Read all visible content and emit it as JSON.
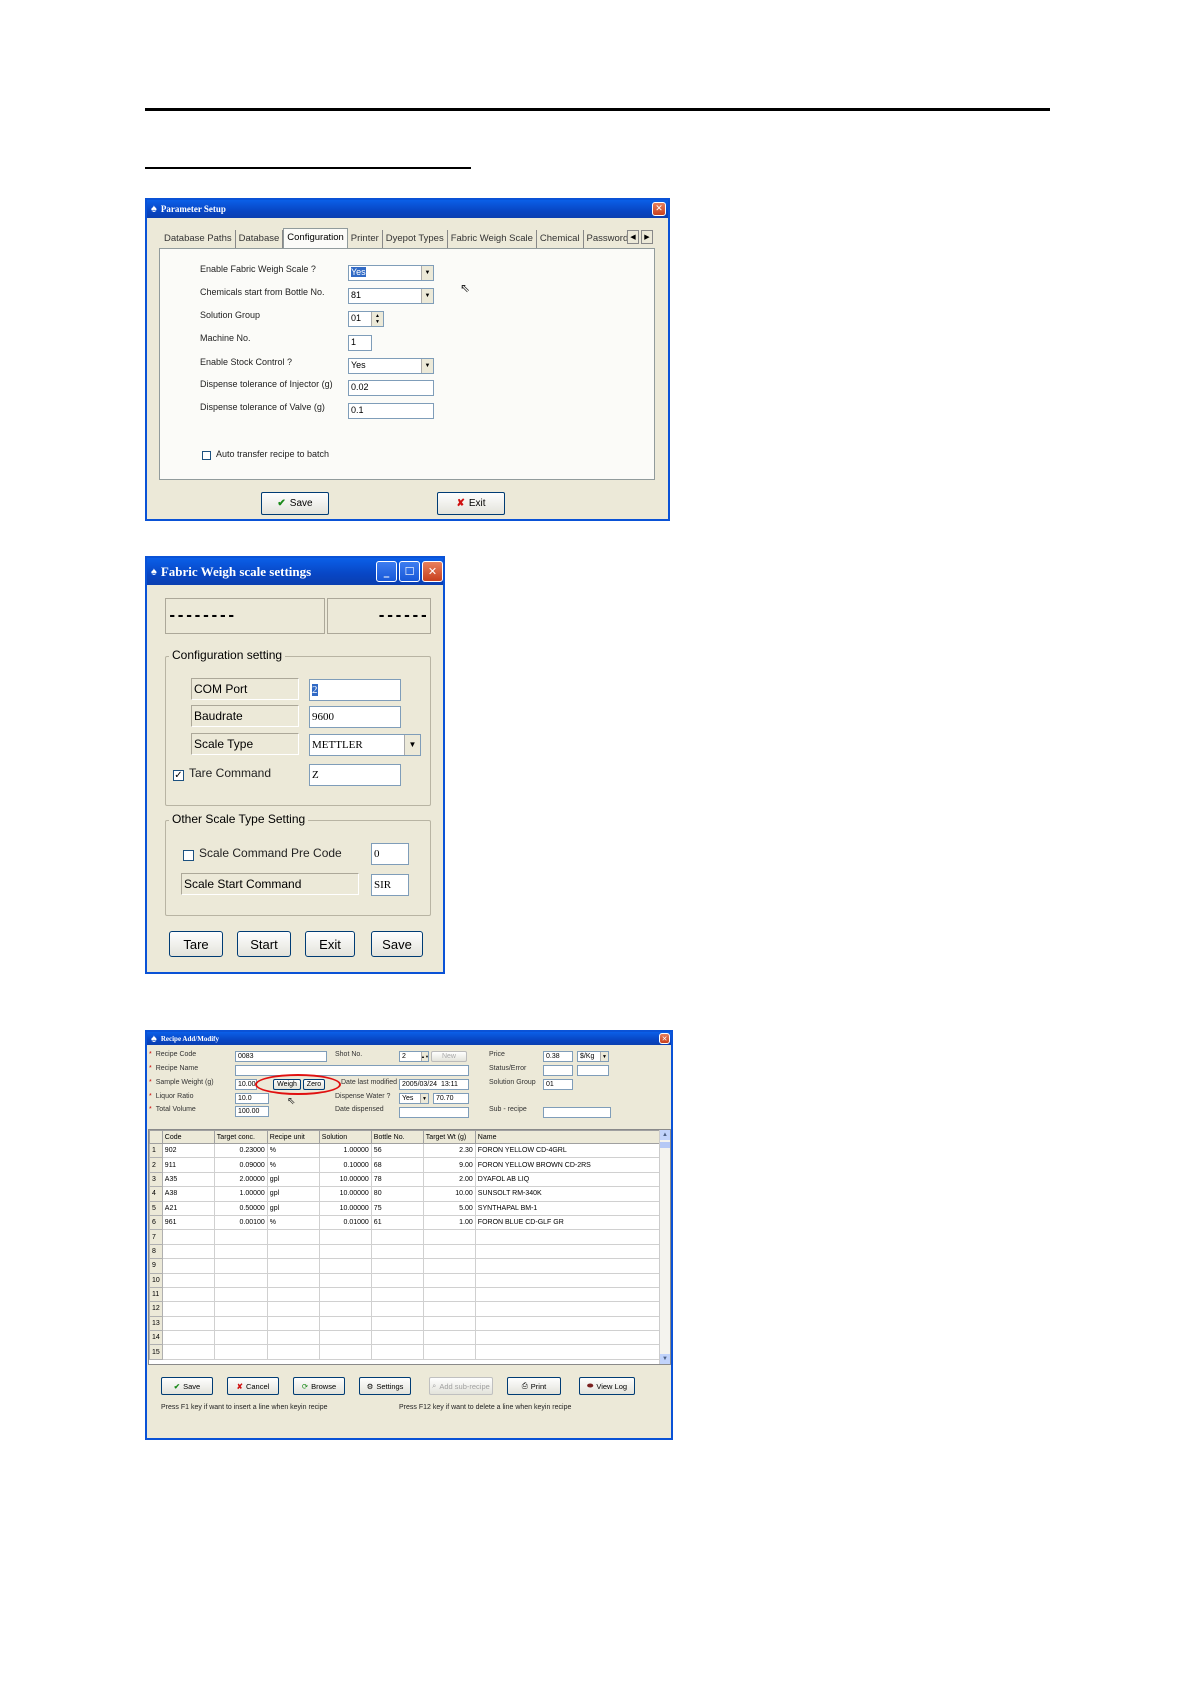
{
  "param_setup": {
    "title": "Parameter Setup",
    "tabs": [
      "Database Paths",
      "Database",
      "Configuration",
      "Printer",
      "Dyepot Types",
      "Fabric Weigh Scale",
      "Chemical",
      "Password"
    ],
    "active_tab": "Configuration",
    "fields": {
      "enable_fabric_label": "Enable Fabric Weigh Scale ?",
      "enable_fabric_value": "Yes",
      "chem_start_label": "Chemicals start from Bottle No.",
      "chem_start_value": "81",
      "solution_group_label": "Solution Group",
      "solution_group_value": "01",
      "machine_no_label": "Machine No.",
      "machine_no_value": "1",
      "stock_control_label": "Enable Stock Control ?",
      "stock_control_value": "Yes",
      "tol_injector_label": "Dispense tolerance of Injector (g)",
      "tol_injector_value": "0.02",
      "tol_valve_label": "Dispense tolerance of Valve (g)",
      "tol_valve_value": "0.1",
      "auto_transfer_label": "Auto transfer recipe to batch"
    },
    "buttons": {
      "save": "Save",
      "exit": "Exit"
    }
  },
  "fabric_scale": {
    "title": "Fabric Weigh scale settings",
    "display_left": "--------",
    "display_right": "------",
    "config_group": "Configuration setting",
    "com_port_label": "COM Port",
    "com_port_value": "2",
    "baudrate_label": "Baudrate",
    "baudrate_value": "9600",
    "scale_type_label": "Scale Type",
    "scale_type_value": "METTLER",
    "tare_cmd_label": "Tare Command",
    "tare_cmd_value": "Z",
    "tare_cmd_checked": true,
    "other_group": "Other Scale Type Setting",
    "pre_code_label": "Scale Command Pre Code",
    "pre_code_value": "0",
    "start_cmd_label": "Scale Start Command",
    "start_cmd_value": "SIR",
    "buttons": {
      "tare": "Tare",
      "start": "Start",
      "exit": "Exit",
      "save": "Save"
    }
  },
  "recipe": {
    "title": "Recipe Add/Modify",
    "recipe_code_label": "Recipe Code",
    "recipe_code_value": "0083",
    "recipe_name_label": "Recipe Name",
    "recipe_name_value": "",
    "sample_weight_label": "Sample Weight (g)",
    "sample_weight_value": "10.00",
    "weigh_btn": "Weigh",
    "zero_btn": "Zero",
    "liquor_ratio_label": "Liquor Ratio",
    "liquor_ratio_value": "10.0",
    "total_volume_label": "Total Volume",
    "total_volume_value": "100.00",
    "shot_no_label": "Shot No.",
    "shot_no_value": "2",
    "new_btn": "New",
    "last_modified_label": "Date last modified",
    "last_modified_date": "2005/03/24",
    "last_modified_time": "13:11",
    "dispense_water_label": "Dispense Water ?",
    "dispense_water_value": "Yes",
    "dispense_water_amount": "70.70",
    "date_dispensed_label": "Date dispensed",
    "price_label": "Price",
    "price_value": "0.38",
    "price_unit": "$/Kg",
    "status_label": "Status/Error",
    "solution_group_label": "Solution Group",
    "solution_group_value": "01",
    "sub_recipe_label": "Sub - recipe",
    "columns": [
      "Code",
      "Target conc.",
      "Recipe unit",
      "Solution",
      "Bottle No.",
      "Target Wt (g)",
      "Name"
    ],
    "rows": [
      [
        "902",
        "0.23000",
        "%",
        "1.00000",
        "56",
        "2.30",
        "FORON YELLOW CD-4GRL"
      ],
      [
        "911",
        "0.09000",
        "%",
        "0.10000",
        "68",
        "9.00",
        "FORON YELLOW BROWN CD-2RS"
      ],
      [
        "A35",
        "2.00000",
        "gpl",
        "10.00000",
        "78",
        "2.00",
        "DYAFOL AB LIQ"
      ],
      [
        "A38",
        "1.00000",
        "gpl",
        "10.00000",
        "80",
        "10.00",
        "SUNSOLT RM-340K"
      ],
      [
        "A21",
        "0.50000",
        "gpl",
        "10.00000",
        "75",
        "5.00",
        "SYNTHAPAL BM-1"
      ],
      [
        "961",
        "0.00100",
        "%",
        "0.01000",
        "61",
        "1.00",
        "FORON BLUE CD-GLF GR"
      ]
    ],
    "row_numbers": [
      "1",
      "2",
      "3",
      "4",
      "5",
      "6",
      "7",
      "8",
      "9",
      "10",
      "11",
      "12",
      "13",
      "14",
      "15"
    ],
    "buttons": {
      "save": "Save",
      "cancel": "Cancel",
      "browse": "Browse",
      "settings": "Settings",
      "sub_recipe": "Add sub-recipe",
      "print": "Print",
      "view_log": "View Log"
    },
    "hint_f1": "Press F1 key if want to insert a line when keyin recipe",
    "hint_f12": "Press F12 key if want to delete a line when keyin recipe"
  }
}
